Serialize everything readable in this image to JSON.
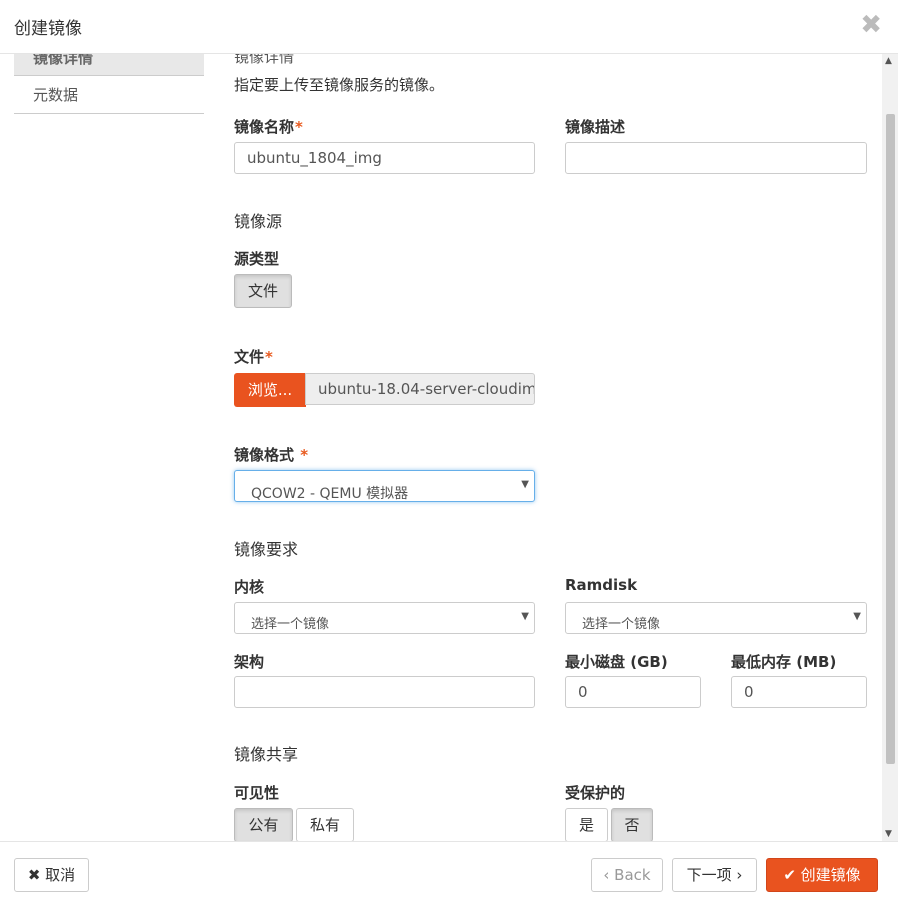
{
  "modal": {
    "title": "创建镜像",
    "close_glyph": "✖"
  },
  "sidebar": {
    "items": [
      {
        "label": "镜像详情"
      },
      {
        "label": "元数据"
      }
    ]
  },
  "details": {
    "section_title": "镜像详情",
    "help": "指定要上传至镜像服务的镜像。",
    "name_label": "镜像名称",
    "name_value": "ubuntu_1804_img",
    "desc_label": "镜像描述",
    "desc_value": ""
  },
  "source": {
    "heading": "镜像源",
    "type_label": "源类型",
    "type_button": "文件",
    "file_label": "文件",
    "browse_label": "浏览...",
    "file_name": "ubuntu-18.04-server-cloudim"
  },
  "format": {
    "label": "镜像格式",
    "value": "QCOW2 - QEMU 模拟器"
  },
  "requirements": {
    "heading": "镜像要求",
    "kernel_label": "内核",
    "kernel_value": "选择一个镜像",
    "ramdisk_label": "Ramdisk",
    "ramdisk_value": "选择一个镜像",
    "arch_label": "架构",
    "arch_value": "",
    "min_disk_label": "最小磁盘 (GB)",
    "min_disk_value": "0",
    "min_ram_label": "最低内存 (MB)",
    "min_ram_value": "0"
  },
  "sharing": {
    "heading": "镜像共享",
    "visibility_label": "可见性",
    "public_label": "公有",
    "private_label": "私有",
    "protected_label": "受保护的",
    "yes_label": "是",
    "no_label": "否"
  },
  "footer": {
    "cancel_label": "取消",
    "back_label": "Back",
    "next_label": "下一项",
    "create_label": "创建镜像"
  },
  "colors": {
    "accent": "#e9531f",
    "required": "#e85a1f",
    "focus": "#66afe9"
  }
}
